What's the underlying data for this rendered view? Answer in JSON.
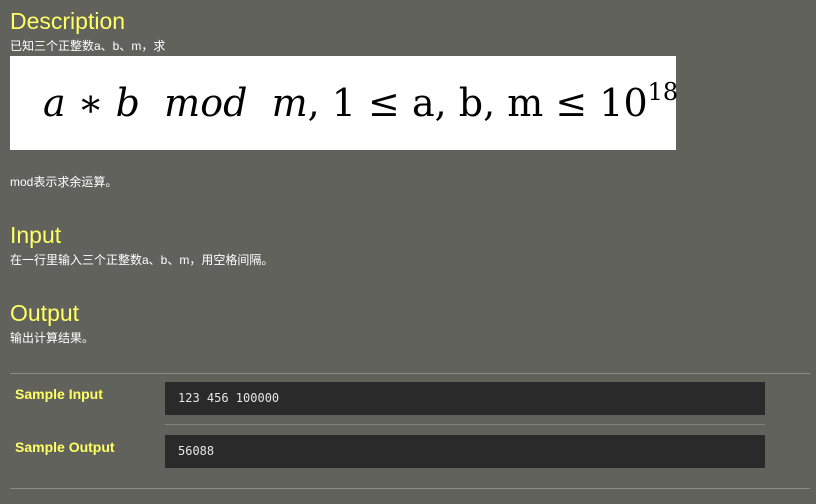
{
  "description": {
    "title": "Description",
    "text": "已知三个正整数a、b、m，求",
    "formula": {
      "a": "a",
      "op_times": "∗",
      "b": "b",
      "mod": "mod",
      "m": "m",
      "rest": ", 1 ≤ a, b, m ≤ 10",
      "exponent": "18"
    },
    "note": "mod表示求余运算。"
  },
  "input": {
    "title": "Input",
    "text": "在一行里输入三个正整数a、b、m，用空格间隔。"
  },
  "output": {
    "title": "Output",
    "text": "输出计算结果。"
  },
  "samples": {
    "input_label": "Sample Input",
    "input_value": "123 456 100000",
    "output_label": "Sample Output",
    "output_value": "56088"
  }
}
